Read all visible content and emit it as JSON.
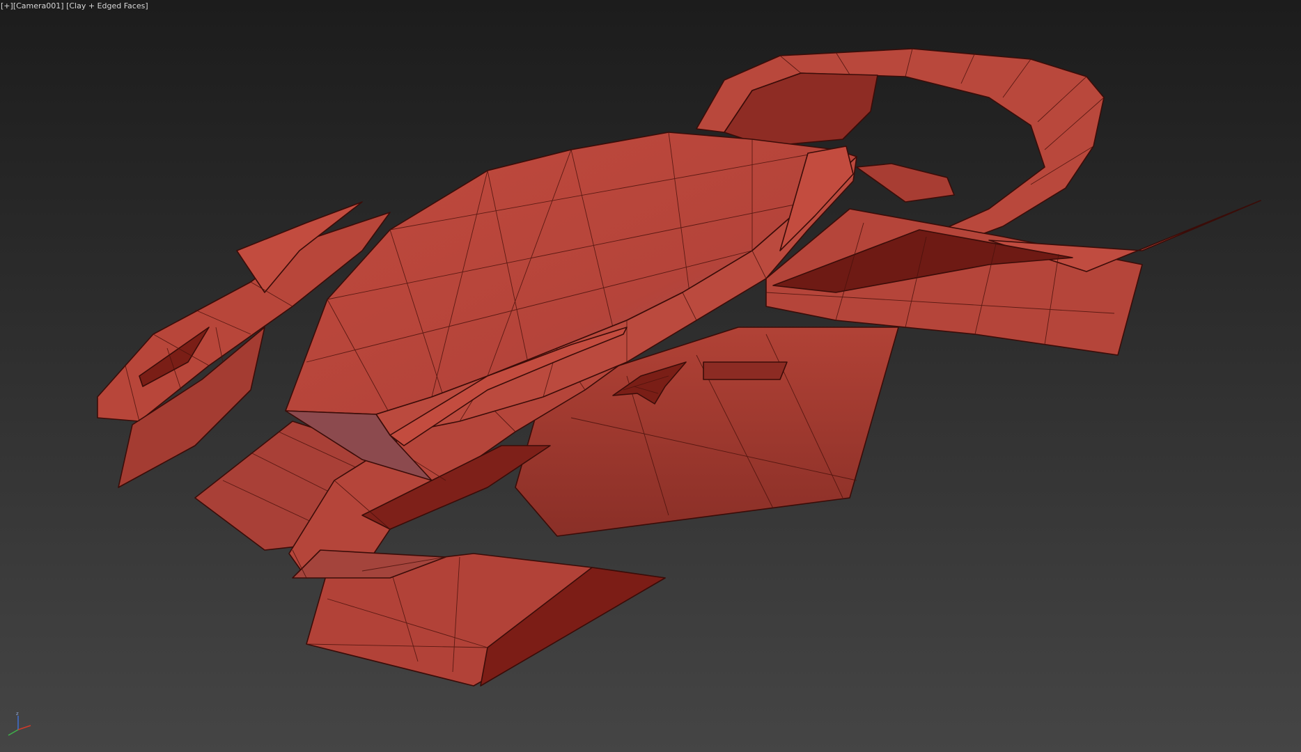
{
  "viewport": {
    "label_menu": "[+]",
    "label_camera": "[Camera001]",
    "label_shading": "[Clay + Edged Faces]"
  },
  "gizmo": {
    "z_label": "z",
    "colors": {
      "x": "#d23a2a",
      "y": "#3fb34a",
      "z": "#3f6fd2"
    }
  },
  "model": {
    "clay_color": "#b84338",
    "edge_color": "#3a0c08"
  }
}
